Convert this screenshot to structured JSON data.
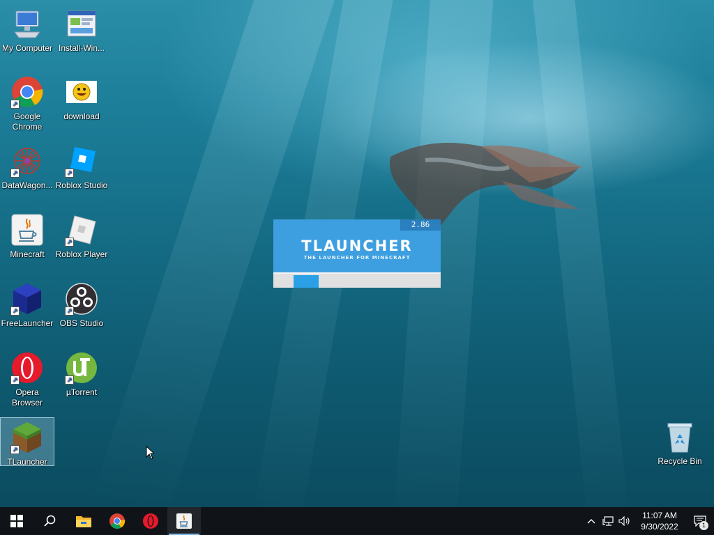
{
  "desktop": {
    "icons": [
      {
        "label": "My Computer",
        "icon": "monitor-icon"
      },
      {
        "label": "Install-Win...",
        "icon": "installer-icon"
      },
      {
        "label": "Google Chrome",
        "icon": "chrome-icon"
      },
      {
        "label": "download",
        "icon": "smiley-image-icon"
      },
      {
        "label": "DataWagon...",
        "icon": "datawagon-icon"
      },
      {
        "label": "Roblox Studio",
        "icon": "roblox-studio-icon"
      },
      {
        "label": "Minecraft",
        "icon": "java-icon"
      },
      {
        "label": "Roblox Player",
        "icon": "roblox-player-icon"
      },
      {
        "label": "FreeLauncher",
        "icon": "cube-icon"
      },
      {
        "label": "OBS Studio",
        "icon": "obs-icon"
      },
      {
        "label": "Opera Browser",
        "icon": "opera-icon"
      },
      {
        "label": "µTorrent",
        "icon": "utorrent-icon"
      },
      {
        "label": "TLauncher",
        "icon": "grass-block-icon"
      },
      {
        "label": "Recycle Bin",
        "icon": "recycle-bin-icon"
      }
    ]
  },
  "splash": {
    "version": "2.86",
    "title": "TLAUNCHER",
    "subtitle": "THE LAUNCHER FOR MINECRAFT",
    "progress_start": 0.12,
    "progress_end": 0.27,
    "colors": {
      "accent": "#3d9fe0",
      "bar": "#2aa0e6"
    }
  },
  "taskbar": {
    "buttons": [
      {
        "icon": "windows-start-icon"
      },
      {
        "icon": "search-icon"
      },
      {
        "icon": "file-explorer-icon"
      },
      {
        "icon": "chrome-icon"
      },
      {
        "icon": "opera-icon"
      },
      {
        "icon": "java-icon"
      }
    ],
    "clock": {
      "time": "11:07 AM",
      "date": "9/30/2022"
    },
    "tray": [
      "chevron-up-icon",
      "network-icon",
      "volume-icon"
    ],
    "notifications": {
      "count": "1"
    }
  }
}
